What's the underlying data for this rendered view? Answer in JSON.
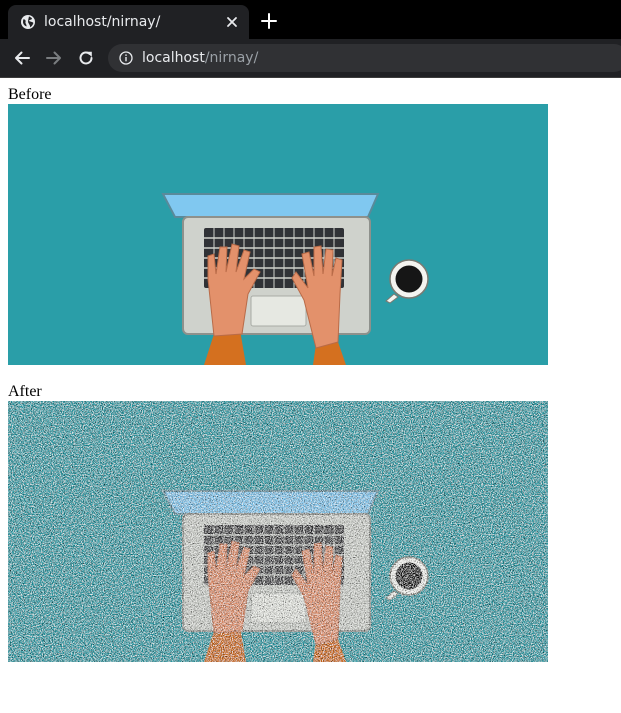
{
  "browser": {
    "tab_title": "localhost/nirnay/",
    "url_host": "localhost",
    "url_path": "/nirnay/"
  },
  "page": {
    "before_label": "Before",
    "after_label": "After"
  },
  "colors": {
    "chrome_bg": "#202124",
    "tabstrip_bg": "#000000",
    "teal_background": "#2a9ea8",
    "laptop_screen": "#80c8f0",
    "laptop_body": "#cfd2cc",
    "hand_skin": "#e3916b",
    "sleeve": "#d4701f"
  },
  "icons": {
    "tab_favicon": "globe-icon",
    "tab_close": "close-icon",
    "new_tab": "plus-icon",
    "back": "arrow-left-icon",
    "forward": "arrow-right-icon",
    "reload": "reload-icon",
    "site_info": "info-icon"
  }
}
